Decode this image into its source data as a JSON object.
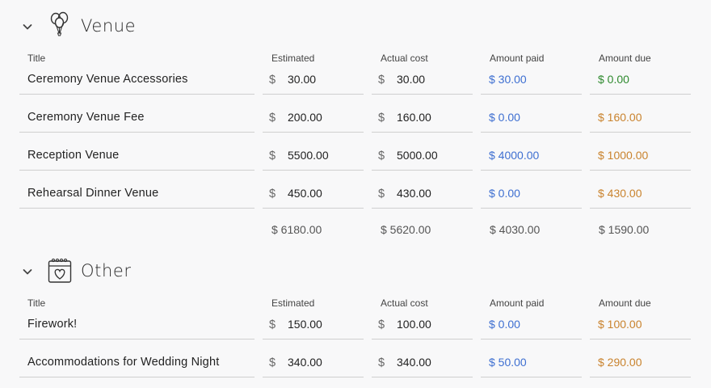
{
  "colors": {
    "paid": "#3e6fd1",
    "due_zero": "#2f8a2f",
    "due_owed": "#c9832e"
  },
  "columns": {
    "title": "Title",
    "estimated": "Estimated",
    "actual": "Actual cost",
    "paid": "Amount paid",
    "due": "Amount due"
  },
  "sections": [
    {
      "title": "Venue",
      "icon": "balloons-icon",
      "rows": [
        {
          "title": "Ceremony Venue Accessories",
          "estimated": "30.00",
          "actual": "30.00",
          "paid": "$ 30.00",
          "due": "$ 0.00"
        },
        {
          "title": "Ceremony Venue Fee",
          "estimated": "200.00",
          "actual": "160.00",
          "paid": "$ 0.00",
          "due": "$ 160.00"
        },
        {
          "title": "Reception Venue",
          "estimated": "5500.00",
          "actual": "5000.00",
          "paid": "$ 4000.00",
          "due": "$ 1000.00"
        },
        {
          "title": "Rehearsal Dinner Venue",
          "estimated": "450.00",
          "actual": "430.00",
          "paid": "$ 0.00",
          "due": "$ 430.00"
        }
      ],
      "totals": {
        "estimated": "$ 6180.00",
        "actual": "$ 5620.00",
        "paid": "$ 4030.00",
        "due": "$ 1590.00"
      }
    },
    {
      "title": "Other",
      "icon": "calendar-heart-icon",
      "rows": [
        {
          "title": "Firework!",
          "estimated": "150.00",
          "actual": "100.00",
          "paid": "$ 0.00",
          "due": "$ 100.00"
        },
        {
          "title": "Accommodations for Wedding Night",
          "estimated": "340.00",
          "actual": "340.00",
          "paid": "$ 50.00",
          "due": "$ 290.00"
        }
      ]
    }
  ],
  "currency_symbol": "$"
}
